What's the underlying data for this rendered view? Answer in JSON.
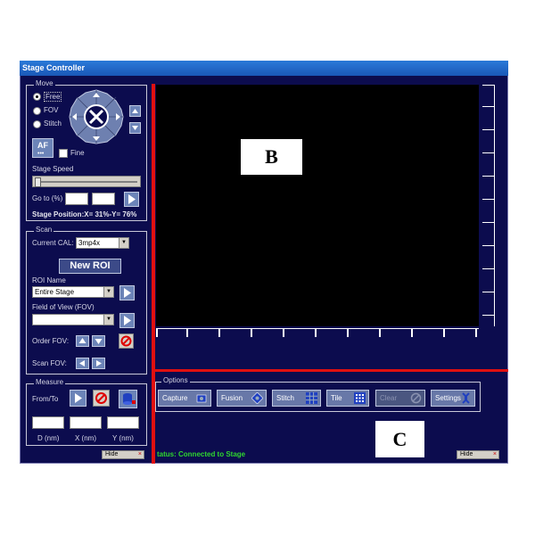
{
  "window": {
    "title": "Stage Controller"
  },
  "move": {
    "legend": "Move",
    "radio_free": "Free",
    "radio_fov": "FOV",
    "radio_stitch": "Stitch",
    "af_label": "AF",
    "fine_label": "Fine",
    "speed_label": "Stage Speed",
    "goto_label": "Go to (%)",
    "position_text": "Stage Position:X= 31%-Y= 76%"
  },
  "scan": {
    "legend": "Scan",
    "cal_label": "Current CAL:",
    "cal_value": "3mp4x",
    "new_roi_label": "New ROI",
    "roi_name_label": "ROI Name",
    "roi_name_value": "Entire Stage",
    "fov_label": "Field of View (FOV)",
    "fov_value": "",
    "order_fov_label": "Order FOV:",
    "scan_fov_label": "Scan FOV:"
  },
  "measure": {
    "legend": "Measure",
    "from_to_label": "From/To",
    "d_label": "D (nm)",
    "x_label": "X (nm)",
    "y_label": "Y (nm)"
  },
  "options": {
    "legend": "Options",
    "buttons": [
      "Capture",
      "Fusion",
      "Stitch",
      "Tile",
      "Clear",
      "Settings"
    ]
  },
  "status": {
    "text": "tatus: Connected to Stage",
    "color": "#2fd62f"
  },
  "hide_label": "Hide",
  "annotations": {
    "b": "B",
    "c": "C"
  },
  "colors": {
    "window_bg": "#0c0c4e",
    "title_bar": "#1a58b8",
    "highlight_line": "#e01010"
  }
}
